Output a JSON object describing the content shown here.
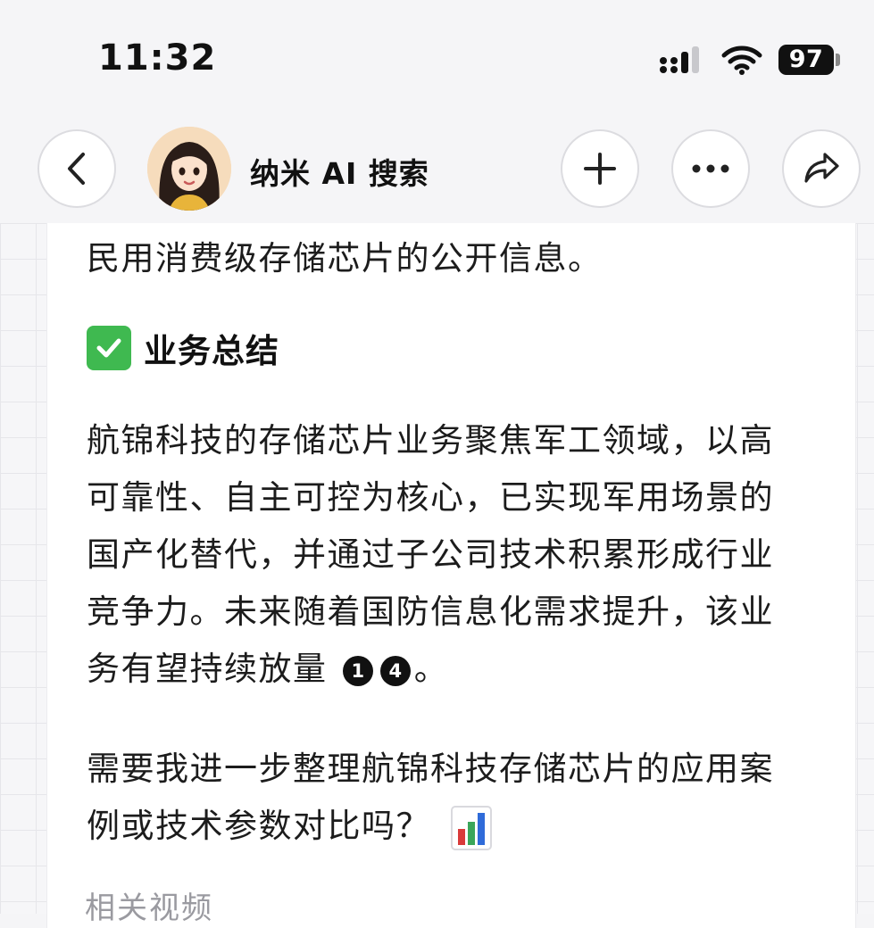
{
  "status_bar": {
    "time": "11:32",
    "battery": "97",
    "icons": [
      "signal-icon",
      "wifi-icon",
      "battery-icon"
    ]
  },
  "header": {
    "title": "纳米 AI 搜索",
    "buttons": [
      "back-icon",
      "plus-icon",
      "more-icon",
      "share-icon"
    ]
  },
  "content": {
    "top_line": "民用消费级存储芯片的公开信息。",
    "section_heading": "业务总结",
    "paragraph": "航锦科技的存储芯片业务聚焦军工领域，以高可靠性、自主可控为核心，已实现军用场景的国产化替代，并通过子公司技术积累形成行业竞争力。未来随着国防信息化需求提升，该业务有望持续放量",
    "citations": [
      "1",
      "4"
    ],
    "paragraph_end": "。",
    "question": "需要我进一步整理航锦科技存储芯片的应用案例或技术参数对比吗？",
    "related_label": "相关视频"
  },
  "colors": {
    "check_green": "#3fb950",
    "background": "#f5f5f7",
    "card": "#ffffff"
  }
}
